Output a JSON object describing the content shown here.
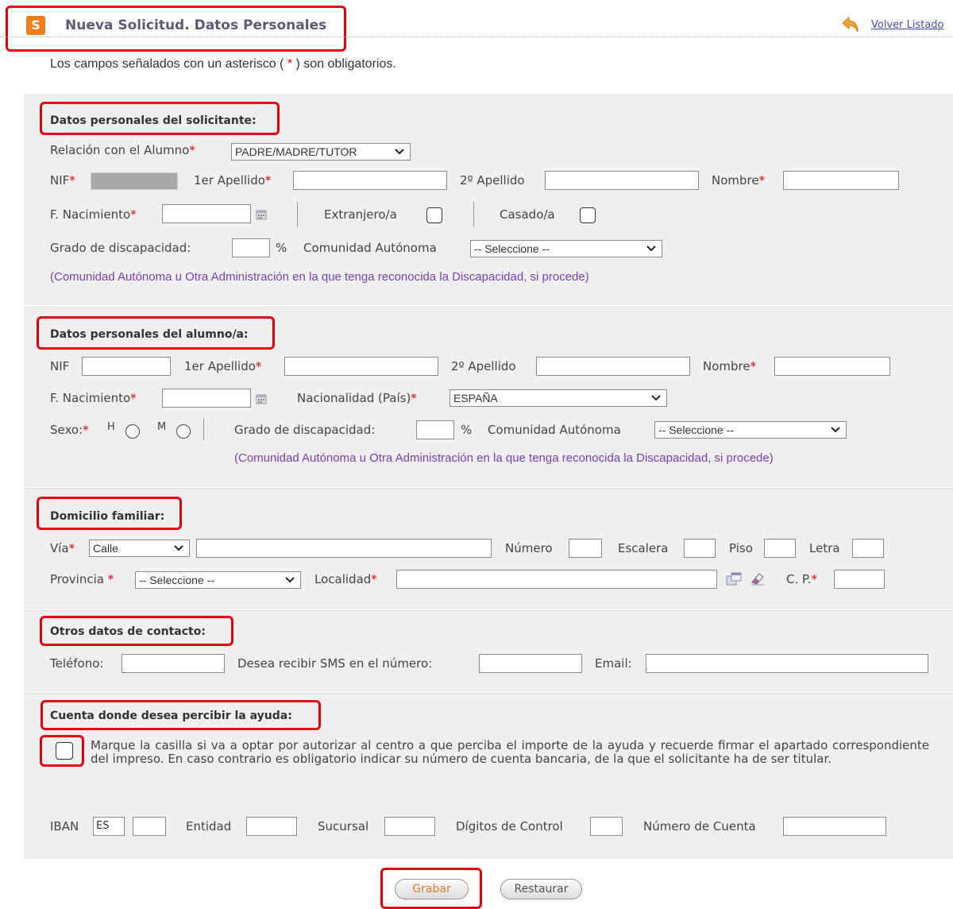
{
  "header": {
    "logo_glyph": "S",
    "title": "Nueva Solicitud. Datos Personales",
    "back_link": "Volver Listado"
  },
  "note": {
    "before": "Los campos señalados con un asterisco (",
    "asterisk": " * ",
    "after": ") son obligatorios."
  },
  "asterisk": "*",
  "percent": "%",
  "solicitante": {
    "title": "Datos personales del solicitante:",
    "relacion_label": "Relación con el Alumno",
    "relacion_value": "PADRE/MADRE/TUTOR",
    "nif_label": "NIF",
    "apellido1_label": "1er Apellido",
    "apellido2_label": "2º Apellido",
    "nombre_label": "Nombre",
    "fnac_label": "F. Nacimiento",
    "extranjero_label": "Extranjero/a",
    "casado_label": "Casado/a",
    "discapacidad_label": "Grado de discapacidad:",
    "comunidad_label": "Comunidad Autónoma",
    "comunidad_value": "-- Seleccione --",
    "nota": "(Comunidad Autónoma u Otra Administración en la que tenga reconocida la Discapacidad, si procede)"
  },
  "alumno": {
    "title": "Datos personales del alumno/a:",
    "nif_label": "NIF",
    "apellido1_label": "1er Apellido",
    "apellido2_label": "2º Apellido",
    "nombre_label": "Nombre",
    "fnac_label": "F. Nacimiento",
    "nacionalidad_label": "Nacionalidad (País)",
    "nacionalidad_value": "ESPAÑA",
    "sexo_label": "Sexo:",
    "sexo_h": "H",
    "sexo_m": "M",
    "discapacidad_label": "Grado de discapacidad:",
    "comunidad_label": "Comunidad Autónoma",
    "comunidad_value": "-- Seleccione --",
    "nota": "(Comunidad Autónoma u Otra Administración en la que tenga reconocida la Discapacidad, si procede)"
  },
  "domicilio": {
    "title": "Domicilio familiar:",
    "via_label": "Vía",
    "via_value": "Calle",
    "numero_label": "Número",
    "escalera_label": "Escalera",
    "piso_label": "Piso",
    "letra_label": "Letra",
    "provincia_label": "Provincia",
    "provincia_value": "-- Seleccione --",
    "localidad_label": "Localidad",
    "cp_label": "C. P."
  },
  "contacto": {
    "title": "Otros datos de contacto:",
    "telefono_label": "Teléfono:",
    "sms_label": "Desea recibir SMS en el número:",
    "email_label": "Email:"
  },
  "cuenta": {
    "title": "Cuenta donde desea percibir la ayuda:",
    "texto": "Marque la casilla si va a optar por autorizar al centro a que perciba el importe de la ayuda y recuerde firmar el apartado correspondiente del impreso. En caso contrario es obligatorio indicar su número de cuenta bancaria, de la que el solicitante ha de ser titular.",
    "iban_label": "IBAN",
    "iban_value": "ES",
    "entidad_label": "Entidad",
    "sucursal_label": "Sucursal",
    "digitos_label": "Dígitos de Control",
    "numero_cuenta_label": "Número de Cuenta"
  },
  "buttons": {
    "grabar": "Grabar",
    "restaurar": "Restaurar"
  },
  "colors": {
    "accent_red": "#e3000f",
    "note_purple": "#7b3fb5",
    "panel_bg": "#efefef",
    "logo_orange": "#f07d1c"
  }
}
